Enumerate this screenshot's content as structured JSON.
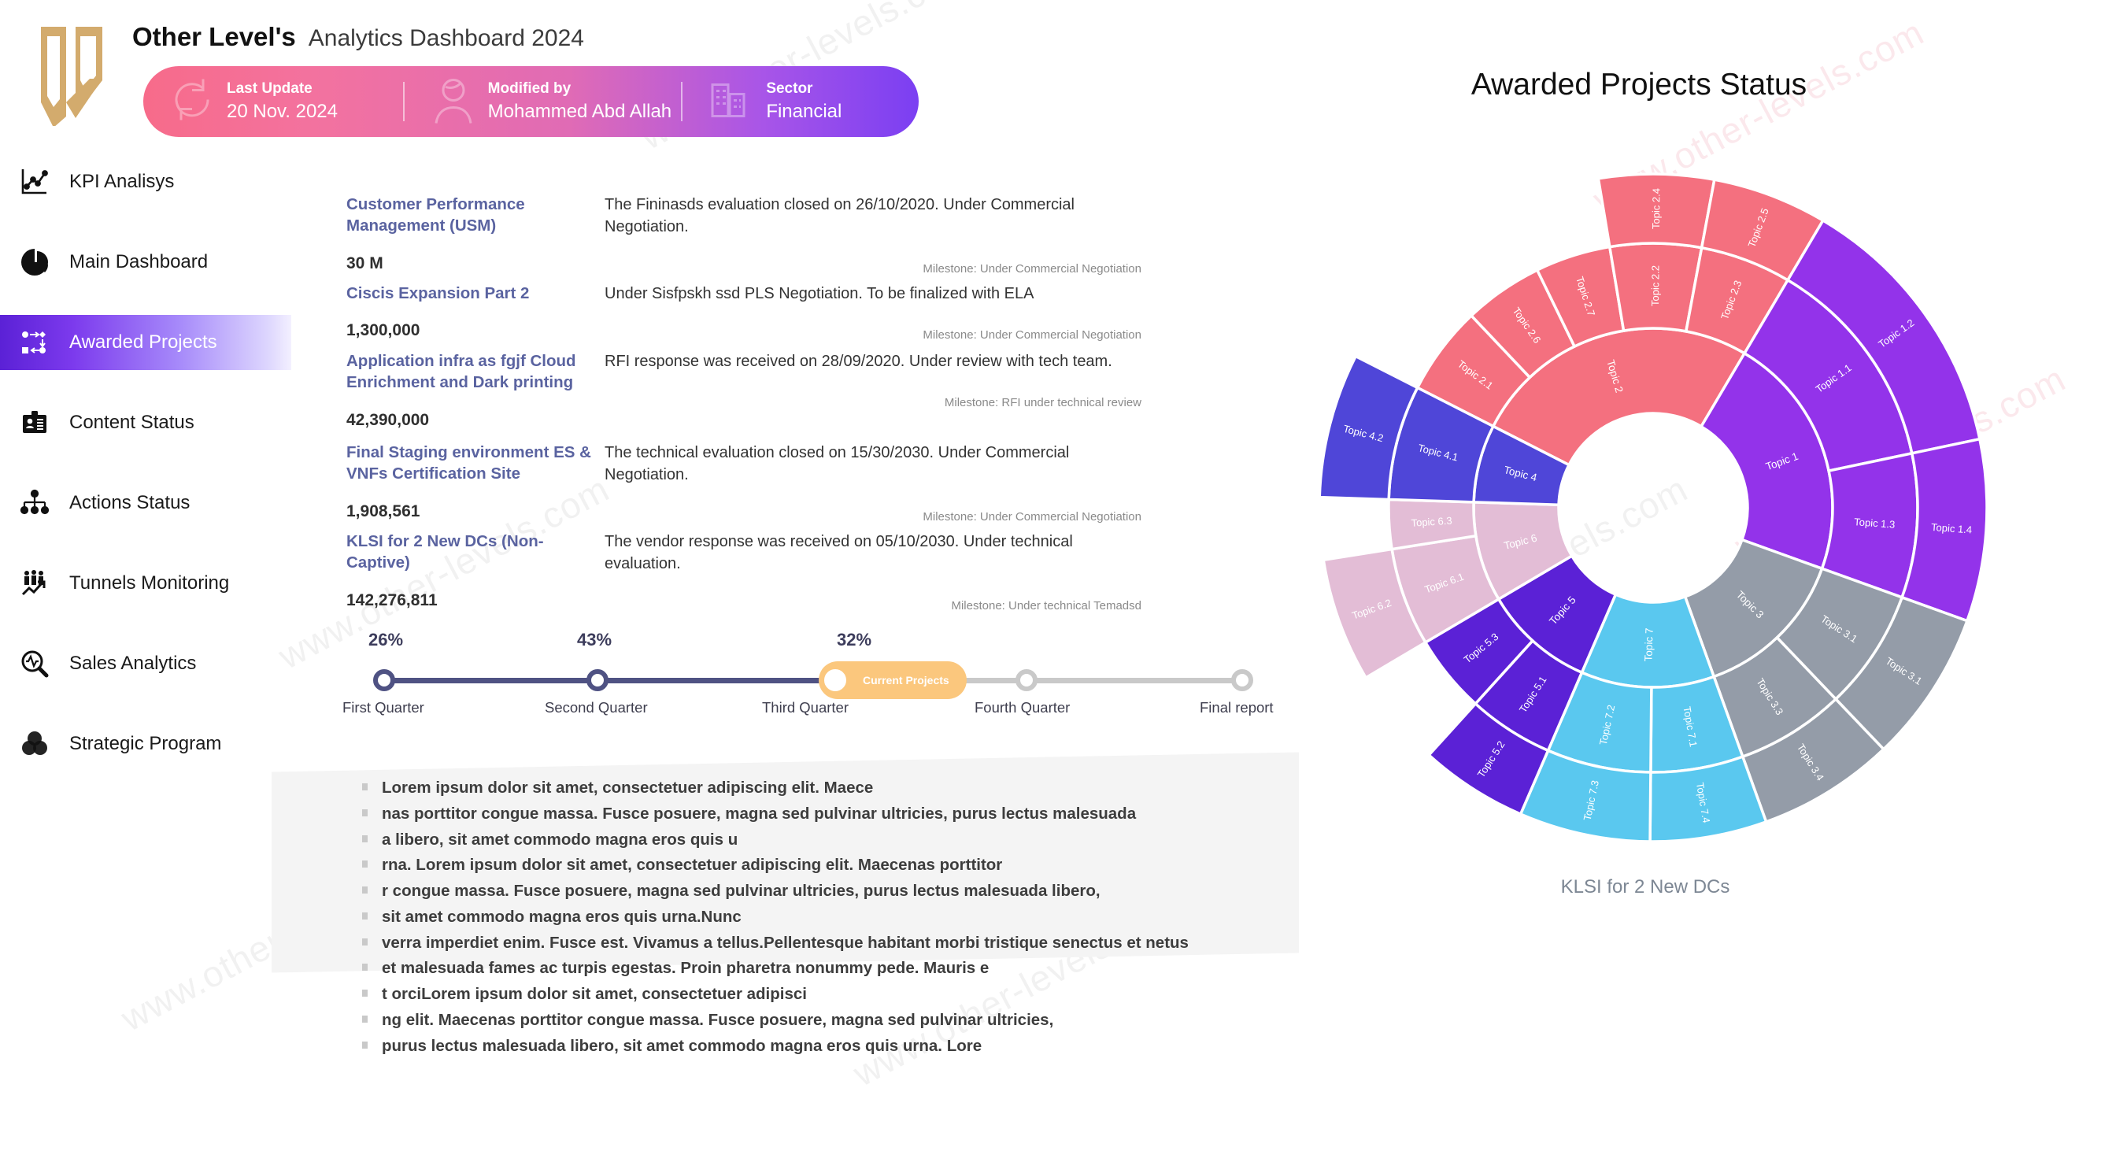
{
  "brand": {
    "name": "Other Level's",
    "subtitle": "Analytics Dashboard 2024",
    "logo_icon": "other-levels-logo"
  },
  "ribbon": {
    "cells": [
      {
        "label": "Last Update",
        "value": "20 Nov. 2024",
        "icon": "refresh-icon"
      },
      {
        "label": "Modified by",
        "value": "Mohammed Abd Allah",
        "icon": "user-icon"
      },
      {
        "label": "Sector",
        "value": "Financial",
        "icon": "building-icon"
      }
    ]
  },
  "sidebar": {
    "items": [
      {
        "label": "KPI Analisys",
        "icon": "line-chart-icon",
        "active": false
      },
      {
        "label": "Main Dashboard",
        "icon": "pie-chart-icon",
        "active": false
      },
      {
        "label": "Awarded Projects",
        "icon": "workflow-icon",
        "active": true
      },
      {
        "label": "Content Status",
        "icon": "id-card-icon",
        "active": false
      },
      {
        "label": "Actions Status",
        "icon": "org-chart-icon",
        "active": false
      },
      {
        "label": "Tunnels Monitoring",
        "icon": "people-growth-icon",
        "active": false
      },
      {
        "label": "Sales Analytics",
        "icon": "magnifier-pulse-icon",
        "active": false
      },
      {
        "label": "Strategic Program",
        "icon": "venn-icon",
        "active": false
      }
    ]
  },
  "projects": [
    {
      "title": "Customer Performance Management (USM)",
      "amount": "30 M",
      "description": "The Fininasds evaluation closed on 26/10/2020. Under Commercial Negotiation.",
      "milestone": "Milestone: Under Commercial Negotiation"
    },
    {
      "title": "Ciscis Expansion Part 2",
      "amount": "1,300,000",
      "description": "Under Sisfpskh ssd PLS Negotiation. To be finalized with ELA",
      "milestone": "Milestone: Under Commercial Negotiation"
    },
    {
      "title": "Application infra as fgjf Cloud Enrichment and Dark printing",
      "amount": "42,390,000",
      "description": "RFI response was received on 28/09/2020. Under review with tech team.",
      "milestone": "Milestone: RFI under technical review"
    },
    {
      "title": "Final Staging environment ES & VNFs Certification Site",
      "amount": "1,908,561",
      "description": "The technical evaluation closed on 15/30/2030. Under Commercial Negotiation.",
      "milestone": "Milestone: Under Commercial Negotiation"
    },
    {
      "title": "KLSI for 2 New DCs (Non-Captive)",
      "amount": "142,276,811",
      "description": "The vendor response was received on 05/10/2030. Under technical evaluation.",
      "milestone": "Milestone: Under technical Temadsd"
    }
  ],
  "timeline": {
    "current_badge": "Current Projects",
    "steps": [
      {
        "name": "First Quarter",
        "percent": "26%",
        "state": "done"
      },
      {
        "name": "Second Quarter",
        "percent": "43%",
        "state": "done"
      },
      {
        "name": "Third Quarter",
        "percent": "32%",
        "state": "current"
      },
      {
        "name": "Fourth Quarter",
        "percent": "",
        "state": "todo"
      },
      {
        "name": "Final report",
        "percent": "",
        "state": "todo"
      }
    ]
  },
  "lorem_lines": [
    "Lorem ipsum dolor sit amet, consectetuer adipiscing elit. Maece",
    "nas porttitor congue massa. Fusce posuere, magna sed pulvinar ultricies, purus lectus malesuada",
    "a libero, sit amet commodo magna eros quis u",
    "rna. Lorem ipsum dolor sit amet, consectetuer adipiscing elit. Maecenas porttitor",
    "r congue massa. Fusce posuere, magna sed pulvinar ultricies, purus lectus malesuada libero,",
    "sit amet commodo magna eros quis urna.Nunc",
    "verra imperdiet enim. Fusce est. Vivamus a tellus.Pellentesque habitant morbi tristique senectus et netus",
    " et malesuada fames ac turpis egestas. Proin pharetra nonummy pede. Mauris e",
    "t orciLorem ipsum dolor sit amet, consectetuer adipisci",
    "ng elit. Maecenas porttitor congue massa. Fusce posuere, magna sed pulvinar ultricies,",
    " purus lectus malesuada libero, sit amet commodo magna eros quis urna. Lore"
  ],
  "chart_header": {
    "title": "Awarded Projects Status",
    "caption": "KLSI for 2 New DCs"
  },
  "watermarks": [
    "www.other-levels.com",
    "www.other-levels.com",
    "www.other-levels.com",
    "www.other-levels.com",
    "www.other-levels.com",
    "www.other-levels.com",
    "www.other-levels.com"
  ],
  "chart_data": {
    "type": "pie",
    "variant": "sunburst",
    "title": "Awarded Projects Status",
    "caption": "KLSI for 2 New DCs",
    "legend": "none",
    "rings": 3,
    "inner_radius": 120,
    "ring_widths": [
      108,
      108,
      88
    ],
    "start_angle_deg": -63,
    "total_sweep_deg": 360,
    "colors": {
      "topic1": "#9333ea",
      "topic2": "#f4707f",
      "topic3": "#949ca8",
      "topic4": "#4f46d8",
      "topic5": "#5b21d6",
      "topic6": "#e3bdd6",
      "topic7": "#5ac8ef"
    },
    "nodes": [
      {
        "name": "Topic 2",
        "value": 26,
        "color": "#f4707f",
        "children": [
          {
            "name": "Topic 2.1",
            "value": 4.5
          },
          {
            "name": "Topic 2.6",
            "value": 4.0
          },
          {
            "name": "Topic 2.7",
            "value": 3.8
          },
          {
            "name": "Topic 2.2",
            "value": 4.6,
            "children": [
              {
                "name": "Topic 2.4",
                "value": 4.6
              }
            ]
          },
          {
            "name": "Topic 2.3",
            "value": 4.6,
            "children": [
              {
                "name": "Topic 2.5",
                "value": 4.6
              }
            ]
          }
        ]
      },
      {
        "name": "Topic 1",
        "value": 22,
        "color": "#9333ea",
        "children": [
          {
            "name": "Topic 1.1",
            "value": 7.5,
            "children": [
              {
                "name": "Topic 1.2",
                "value": 7.5
              }
            ]
          },
          {
            "name": "Topic 1.3",
            "value": 5.0,
            "children": [
              {
                "name": "Topic 1.4",
                "value": 5.0
              }
            ]
          }
        ]
      },
      {
        "name": "Topic 3",
        "value": 14,
        "color": "#949ca8",
        "children": [
          {
            "name": "Topic 3.1",
            "value": 5.0,
            "children": [
              {
                "name": "Topic 3.1",
                "value": 5.0
              }
            ]
          },
          {
            "name": "Topic 3.3",
            "value": 4.5,
            "children": [
              {
                "name": "Topic 3.4",
                "value": 4.5
              }
            ]
          }
        ]
      },
      {
        "name": "Topic 7",
        "value": 12,
        "color": "#5ac8ef",
        "children": [
          {
            "name": "Topic 7.1",
            "value": 4.0,
            "children": [
              {
                "name": "Topic 7.4",
                "value": 4.0
              }
            ]
          },
          {
            "name": "Topic 7.2",
            "value": 4.5,
            "children": [
              {
                "name": "Topic 7.3",
                "value": 4.5
              }
            ]
          }
        ]
      },
      {
        "name": "Topic 5",
        "value": 10,
        "color": "#5b21d6",
        "children": [
          {
            "name": "Topic 5.1",
            "value": 3.5,
            "children": [
              {
                "name": "Topic 5.2",
                "value": 3.5
              }
            ]
          },
          {
            "name": "Topic 5.3",
            "value": 3.2
          }
        ]
      },
      {
        "name": "Topic 6",
        "value": 9,
        "color": "#e3bdd6",
        "children": [
          {
            "name": "Topic 6.1",
            "value": 5.0,
            "children": [
              {
                "name": "Topic 6.2",
                "value": 5.0
              }
            ]
          },
          {
            "name": "Topic 6.3",
            "value": 2.5
          }
        ]
      },
      {
        "name": "Topic 4",
        "value": 7,
        "color": "#4f46d8",
        "children": [
          {
            "name": "Topic 4.1",
            "value": 5.0,
            "children": [
              {
                "name": "Topic 4.2",
                "value": 5.0
              }
            ]
          }
        ]
      }
    ]
  }
}
